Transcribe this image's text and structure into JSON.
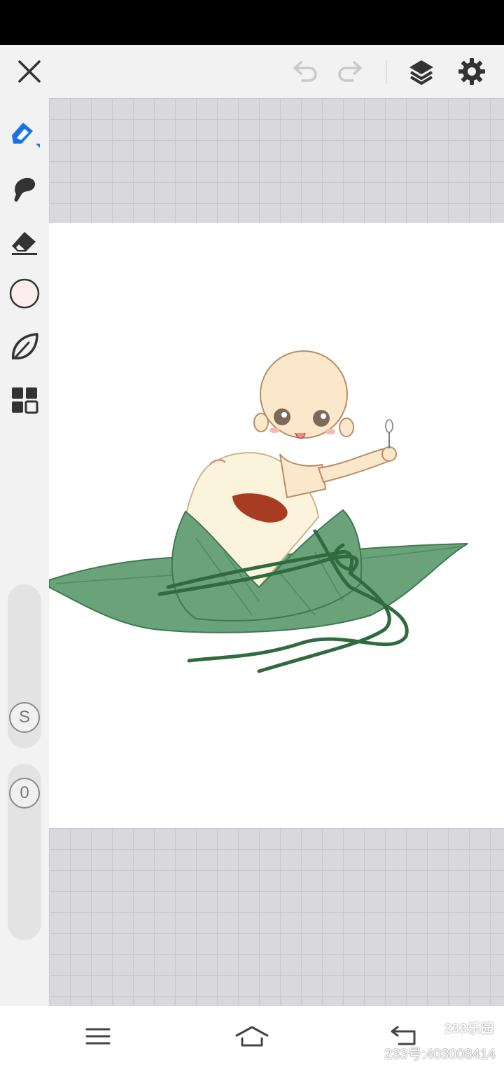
{
  "app_bar": {
    "close_icon": "close-icon",
    "undo_icon": "undo-icon",
    "redo_icon": "redo-icon",
    "layers_icon": "layers-icon",
    "settings_icon": "gear-icon"
  },
  "toolbar": {
    "tools": [
      "brush-icon",
      "smudge-icon",
      "eraser-icon",
      "color-swatch",
      "leaf-icon",
      "grid-menu-icon"
    ],
    "selected_color": "#fceeee",
    "brush_size_label": "S",
    "opacity_label": "0"
  },
  "nav": {
    "menu_icon": "menu-icon",
    "home_icon": "home-icon",
    "back_icon": "back-icon"
  },
  "watermark": {
    "logo": "233乐园",
    "id_text": "233号:403008414"
  },
  "colors": {
    "accent": "#1a73e8",
    "leaf_green": "#6aa27a",
    "string_green": "#2f6b3e"
  }
}
